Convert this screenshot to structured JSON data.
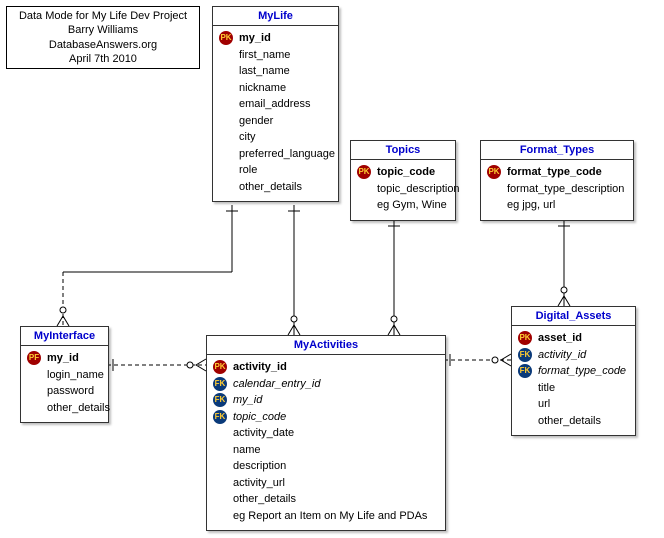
{
  "title": {
    "line1": "Data Mode for My Life Dev Project",
    "line2": "Barry Williams",
    "line3": "DatabaseAnswers.org",
    "line4": "April 7th 2010"
  },
  "entities": {
    "mylife": {
      "name": "MyLife",
      "attrs": [
        {
          "key": "PK",
          "label": "my_id",
          "bold": true
        },
        {
          "label": "first_name"
        },
        {
          "label": "last_name"
        },
        {
          "label": "nickname"
        },
        {
          "label": "email_address"
        },
        {
          "label": "gender"
        },
        {
          "label": "city"
        },
        {
          "label": "preferred_language"
        },
        {
          "label": "role"
        },
        {
          "label": "other_details"
        }
      ]
    },
    "topics": {
      "name": "Topics",
      "attrs": [
        {
          "key": "PK",
          "label": "topic_code",
          "bold": true
        },
        {
          "label": "topic_description"
        },
        {
          "label": "eg Gym, Wine"
        }
      ]
    },
    "format_types": {
      "name": "Format_Types",
      "attrs": [
        {
          "key": "PK",
          "label": "format_type_code",
          "bold": true
        },
        {
          "label": "format_type_description"
        },
        {
          "label": "eg jpg, url"
        }
      ]
    },
    "myinterface": {
      "name": "MyInterface",
      "attrs": [
        {
          "key": "PF",
          "label": "my_id",
          "bold": true
        },
        {
          "label": "login_name"
        },
        {
          "label": "password"
        },
        {
          "label": "other_details"
        }
      ]
    },
    "myactivities": {
      "name": "MyActivities",
      "attrs": [
        {
          "key": "PK",
          "label": "activity_id",
          "bold": true
        },
        {
          "key": "FK",
          "label": "calendar_entry_id",
          "italic": true
        },
        {
          "key": "FK",
          "label": "my_id",
          "italic": true
        },
        {
          "key": "FK",
          "label": "topic_code",
          "italic": true
        },
        {
          "label": "activity_date"
        },
        {
          "label": "name"
        },
        {
          "label": "description"
        },
        {
          "label": "activity_url"
        },
        {
          "label": "other_details"
        },
        {
          "label": "eg Report an Item on My Life and PDAs"
        }
      ]
    },
    "digital_assets": {
      "name": "Digital_Assets",
      "attrs": [
        {
          "key": "PK",
          "label": "asset_id",
          "bold": true
        },
        {
          "key": "FK",
          "label": "activity_id",
          "italic": true
        },
        {
          "key": "FK",
          "label": "format_type_code",
          "italic": true
        },
        {
          "label": "title"
        },
        {
          "label": "url"
        },
        {
          "label": "other_details"
        }
      ]
    }
  }
}
